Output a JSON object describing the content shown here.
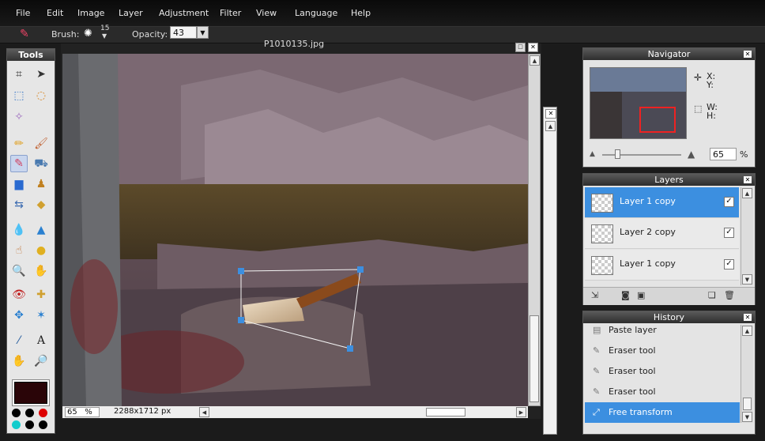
{
  "menu": [
    "File",
    "Edit",
    "Image",
    "Layer",
    "Adjustment",
    "Filter",
    "View",
    "Language",
    "Help"
  ],
  "options": {
    "brush_label": "Brush:",
    "brush_size": "15",
    "opacity_label": "Opacity:",
    "opacity_value": "43"
  },
  "tools_title": "Tools",
  "document": {
    "title": "P1010135.jpg",
    "zoom": "65",
    "zoom_unit": "%",
    "dimensions": "2288x1712 px"
  },
  "navigator": {
    "title": "Navigator",
    "x_label": "X:",
    "y_label": "Y:",
    "w_label": "W:",
    "h_label": "H:",
    "zoom": "65",
    "zoom_unit": "%"
  },
  "layers": {
    "title": "Layers",
    "items": [
      {
        "name": "Layer 1 copy",
        "selected": true,
        "visible": true
      },
      {
        "name": "Layer 2 copy",
        "selected": false,
        "visible": true
      },
      {
        "name": "Layer 1 copy",
        "selected": false,
        "visible": true
      }
    ]
  },
  "history": {
    "title": "History",
    "items": [
      {
        "label": "Paste layer",
        "icon": "paste-icon"
      },
      {
        "label": "Eraser tool",
        "icon": "eraser-icon"
      },
      {
        "label": "Eraser tool",
        "icon": "eraser-icon"
      },
      {
        "label": "Eraser tool",
        "icon": "eraser-icon"
      },
      {
        "label": "Free transform",
        "icon": "transform-icon",
        "selected": true
      }
    ]
  },
  "colors": {
    "foreground": "#2a0508",
    "background": "#000000",
    "accent": "#3c8fe0"
  }
}
